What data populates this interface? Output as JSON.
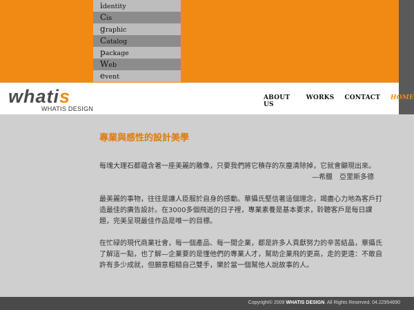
{
  "services": [
    {
      "cap": "i",
      "rest": "dentity",
      "shade": "l"
    },
    {
      "cap": "C",
      "rest": "is",
      "shade": "d"
    },
    {
      "cap": "g",
      "rest": "raphic",
      "shade": "l"
    },
    {
      "cap": "C",
      "rest": "atalog",
      "shade": "d"
    },
    {
      "cap": "p",
      "rest": "ackage",
      "shade": "l"
    },
    {
      "cap": "W",
      "rest": "eb",
      "shade": "d"
    },
    {
      "cap": "e",
      "rest": "vent",
      "shade": "l"
    }
  ],
  "logo": {
    "main": "whati",
    "accent": "s",
    "subtitle": "WHATIS DESIGN"
  },
  "nav": {
    "about": "ABOUT US",
    "works": "WORKS",
    "contact": "CONTACT",
    "home": "HOME"
  },
  "content": {
    "heading": "專業與感性的設計美學",
    "p1": "每塊大理石都蘊含著一座美麗的雕像，只要我們將它積存的灰塵清除掉，它就會顯現出來。",
    "quote": "—希臘　亞里斯多德",
    "p2": "最美麗的事物，往往是讓人臣服於自身的感動。華攝氏堅信著這個理念，竭盡心力地為客戶打造最佳的廣告設計。在3000多個飛逝的日子裡，專業素養是基本要求，聆聽客戶是每日課題，完美呈現最佳作品是唯一的目標。",
    "p3": "在忙碌的現代商業社會，每一個產品、每一間企業，都是許多人貢獻努力的辛苦結晶，華攝氏了解這一點，也了解—企業要的是懂他們的專業人才，幫助企業飛的更高，走的更遠：不敢自許有多少成就，但願意粗糙自己雙手，樂於當一個幫他人說故事的人。"
  },
  "footer": {
    "prefix": "Copyright© 2009 ",
    "brand": "WHATIS DESIGN",
    "suffix": ". All Rights Reserved.  04.22954890"
  },
  "colors": {
    "accent": "#f08a14",
    "dark": "#4a4a4a",
    "background": "#cfcfcf"
  }
}
